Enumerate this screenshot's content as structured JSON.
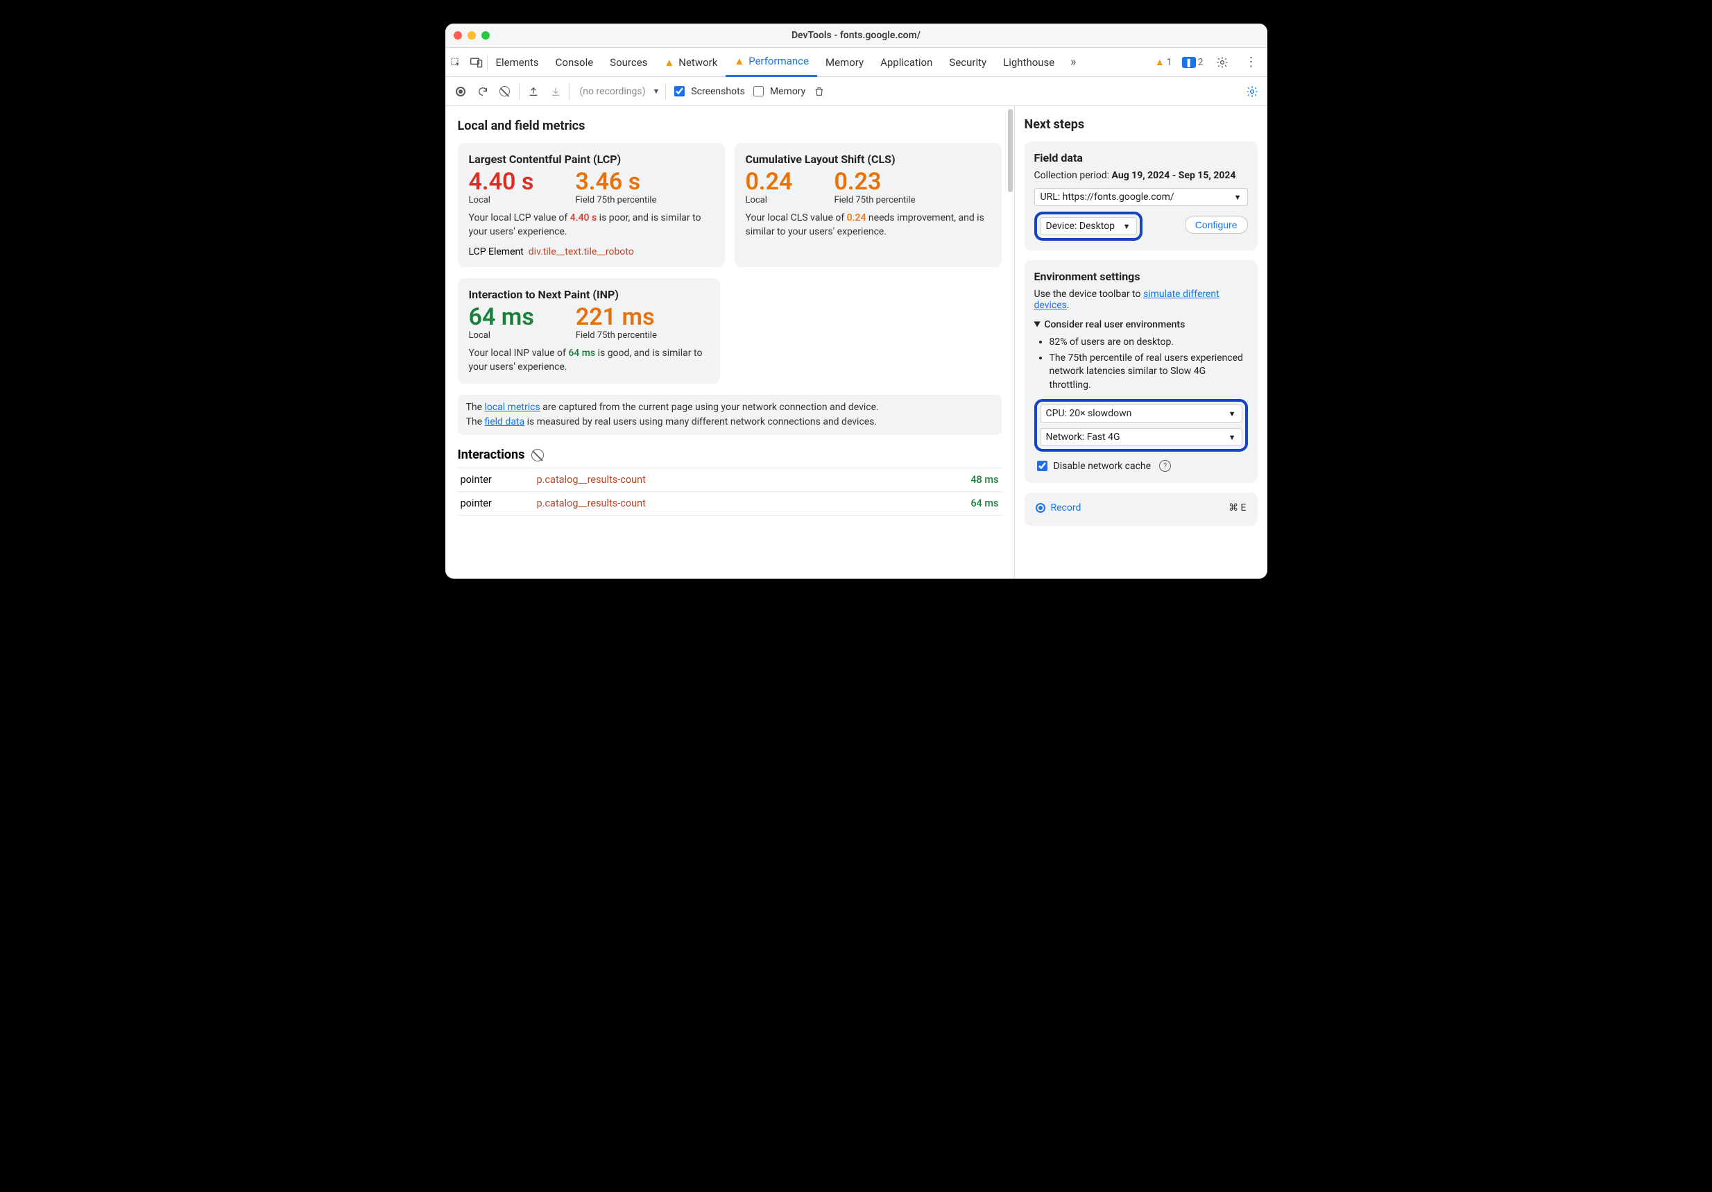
{
  "window": {
    "title": "DevTools - fonts.google.com/"
  },
  "tabs": {
    "items": [
      "Elements",
      "Console",
      "Sources",
      "Network",
      "Performance",
      "Memory",
      "Application",
      "Security",
      "Lighthouse"
    ],
    "warnings": "1",
    "issues": "2"
  },
  "toolbar": {
    "recordings_placeholder": "(no recordings)",
    "screenshots_label": "Screenshots",
    "memory_label": "Memory"
  },
  "main": {
    "heading": "Local and field metrics",
    "lcp": {
      "title": "Largest Contentful Paint (LCP)",
      "local_value": "4.40 s",
      "local_label": "Local",
      "field_value": "3.46 s",
      "field_label": "Field 75th percentile",
      "desc_pre": "Your local LCP value of ",
      "desc_val": "4.40 s",
      "desc_post": " is poor, and is similar to your users' experience.",
      "el_label": "LCP Element",
      "el_selector": "div.tile__text.tile__roboto"
    },
    "cls": {
      "title": "Cumulative Layout Shift (CLS)",
      "local_value": "0.24",
      "local_label": "Local",
      "field_value": "0.23",
      "field_label": "Field 75th percentile",
      "desc_pre": "Your local CLS value of ",
      "desc_val": "0.24",
      "desc_post": " needs improvement, and is similar to your users' experience."
    },
    "inp": {
      "title": "Interaction to Next Paint (INP)",
      "local_value": "64 ms",
      "local_label": "Local",
      "field_value": "221 ms",
      "field_label": "Field 75th percentile",
      "desc_pre": "Your local INP value of ",
      "desc_val": "64 ms",
      "desc_post": " is good, and is similar to your users' experience."
    },
    "banner": {
      "line1_a": "The ",
      "line1_link": "local metrics",
      "line1_b": " are captured from the current page using your network connection and device.",
      "line2_a": "The ",
      "line2_link": "field data",
      "line2_b": " is measured by real users using many different network connections and devices."
    },
    "interactions": {
      "heading": "Interactions",
      "rows": [
        {
          "type": "pointer",
          "selector": "p.catalog__results-count",
          "ms": "48 ms"
        },
        {
          "type": "pointer",
          "selector": "p.catalog__results-count",
          "ms": "64 ms"
        }
      ]
    }
  },
  "side": {
    "heading": "Next steps",
    "field": {
      "title": "Field data",
      "period_label": "Collection period: ",
      "period_value": "Aug 19, 2024 - Sep 15, 2024",
      "url_select": "URL: https://fonts.google.com/",
      "device_select": "Device: Desktop",
      "configure": "Configure"
    },
    "env": {
      "title": "Environment settings",
      "hint_pre": "Use the device toolbar to ",
      "hint_link": "simulate different devices",
      "hint_post": ".",
      "details_summary": "Consider real user environments",
      "bullets": [
        "82% of users are on desktop.",
        "The 75th percentile of real users experienced network latencies similar to Slow 4G throttling."
      ],
      "cpu_select": "CPU: 20× slowdown",
      "net_select": "Network: Fast 4G",
      "disable_cache": "Disable network cache"
    },
    "record": {
      "label": "Record",
      "shortcut": "⌘ E"
    }
  }
}
